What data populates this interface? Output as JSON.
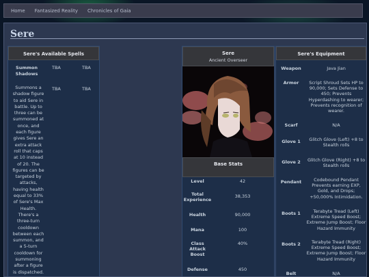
{
  "nav": {
    "items": [
      "Home",
      "Fantasized Reality",
      "Chronicles of Gaia"
    ]
  },
  "page": {
    "title": "Sere"
  },
  "spells": {
    "heading": "Sere's Available Spells",
    "rows": [
      {
        "name": "Summon Shadows",
        "col2": "TBA",
        "col3": "TBA"
      },
      {
        "name": "Summons a shadow figure to aid Sere in battle. Up to three can be summoned at once, and each figure gives Sere an extra attack roll that caps at 10 instead of 20. The figures can be targeted by attacks, having health equal to 33% of Sere's Max Health. There's a three-turn cooldown between each summon, and a 5-turn cooldown for summoning after a figure is dispatched.",
        "col2": "TBA",
        "col3": "TBA"
      }
    ]
  },
  "profile": {
    "name": "Sere",
    "subtitle": "Ancient Overseer",
    "stats_heading": "Base Stats",
    "stats": [
      {
        "label": "Level",
        "value": "42"
      },
      {
        "label": "Total Experience",
        "value": "38,353"
      },
      {
        "label": "Health",
        "value": "90,000"
      },
      {
        "label": "Mana",
        "value": "100"
      },
      {
        "label": "Class Attack Boost",
        "value": "40%"
      },
      {
        "label": "Defense",
        "value": "450"
      }
    ]
  },
  "equipment": {
    "heading": "Sere's Equipment",
    "items": [
      {
        "slot": "Weapon",
        "value": "Java Jian"
      },
      {
        "slot": "Armor",
        "value": "Script Shroud Sets HP to 90,000; Sets Defense to 450; Prevents Hyperdashing to wearer; Prevents recognition of wearer."
      },
      {
        "slot": "Scarf",
        "value": "N/A"
      },
      {
        "slot": "Glove 1",
        "value": "Glitch Glove (Left) +8 to Stealth rolls"
      },
      {
        "slot": "Glove 2",
        "value": "Glitch Glove (Right) +8 to Stealth rolls"
      },
      {
        "slot": "Pendant",
        "value": "Codebound Pendant Prevents earning EXP, Gold, and Drops; +50,000% Intimidation."
      },
      {
        "slot": "Boots 1",
        "value": "Terabyte Tread (Left) Extreme Speed Boost; Extreme Jump Boost; Floor Hazard Immunity"
      },
      {
        "slot": "Boots 2",
        "value": "Terabyte Tread (Right) Extreme Speed Boost; Extreme Jump Boost; Floor Hazard Immunity"
      },
      {
        "slot": "Belt",
        "value": "N/A"
      }
    ]
  }
}
